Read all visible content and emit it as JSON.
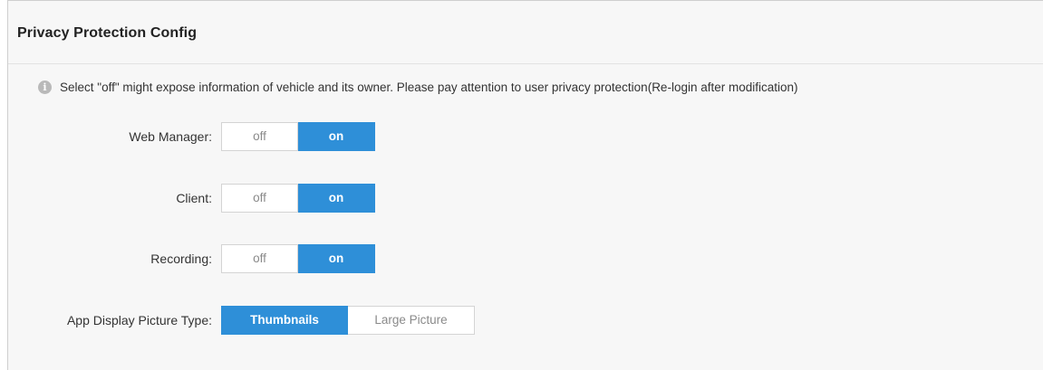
{
  "panel": {
    "title": "Privacy Protection Config",
    "notice": "Select \"off\" might expose information of vehicle and its owner. Please pay attention to user privacy protection(Re-login after modification)"
  },
  "settings": [
    {
      "label": "Web Manager:",
      "options": [
        "off",
        "on"
      ],
      "selected": "on"
    },
    {
      "label": "Client:",
      "options": [
        "off",
        "on"
      ],
      "selected": "on"
    },
    {
      "label": "Recording:",
      "options": [
        "off",
        "on"
      ],
      "selected": "on"
    },
    {
      "label": "App Display Picture Type:",
      "options": [
        "Thumbnails",
        "Large Picture"
      ],
      "selected": "Thumbnails"
    }
  ],
  "colors": {
    "accent": "#2e8fd8",
    "panel_bg": "#f7f7f7",
    "info_icon": "#b9b9b9"
  }
}
